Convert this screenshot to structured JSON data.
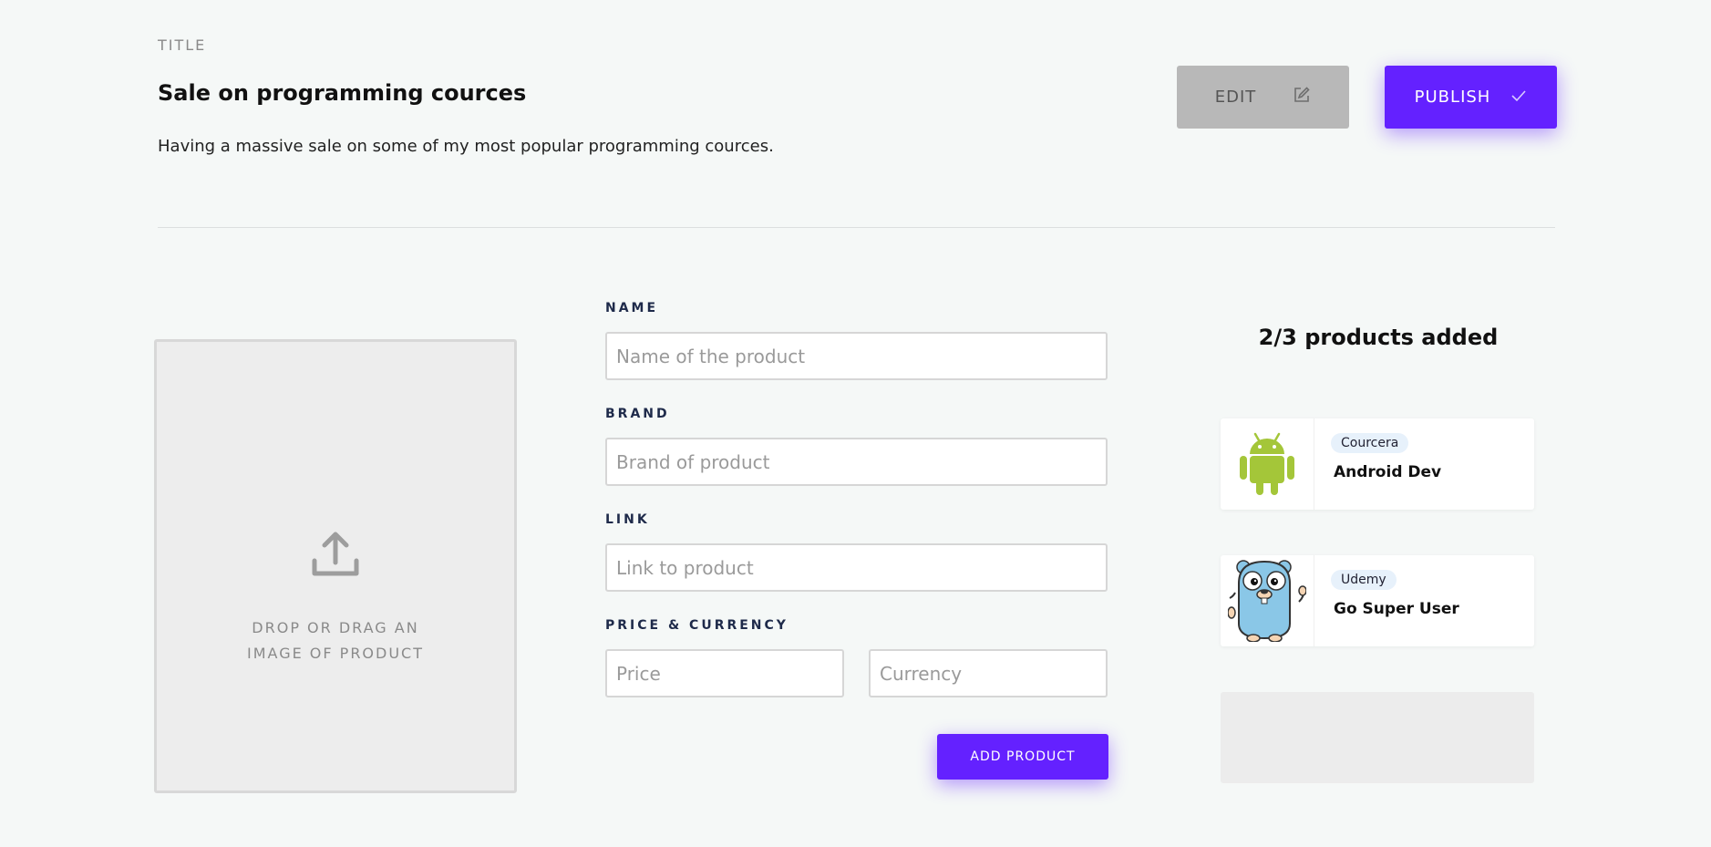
{
  "header": {
    "title_label": "TITLE",
    "title": "Sale on programming cources",
    "description": "Having a massive sale on some of my most popular programming cources.",
    "edit_label": "EDIT",
    "publish_label": "PUBLISH"
  },
  "dropzone": {
    "text_line1": "DROP OR DRAG AN",
    "text_line2": "IMAGE OF PRODUCT",
    "icon": "upload-icon"
  },
  "form": {
    "name_label": "NAME",
    "name_placeholder": "Name of the product",
    "brand_label": "BRAND",
    "brand_placeholder": "Brand of product",
    "link_label": "LINK",
    "link_placeholder": "Link to product",
    "price_currency_label": "PRICE & CURRENCY",
    "price_placeholder": "Price",
    "currency_placeholder": "Currency",
    "add_label": "ADD PRODUCT"
  },
  "products": {
    "count_text": "2/3 products added",
    "items": [
      {
        "brand": "Courcera",
        "name": "Android Dev",
        "icon": "android-icon"
      },
      {
        "brand": "Udemy",
        "name": "Go Super User",
        "icon": "gopher-icon"
      }
    ]
  },
  "colors": {
    "accent": "#6421ff",
    "edit_bg": "#b8b8b8",
    "page_bg": "#f5f8f7",
    "android_green": "#a4c639",
    "gopher_blue": "#8ac7e7"
  }
}
